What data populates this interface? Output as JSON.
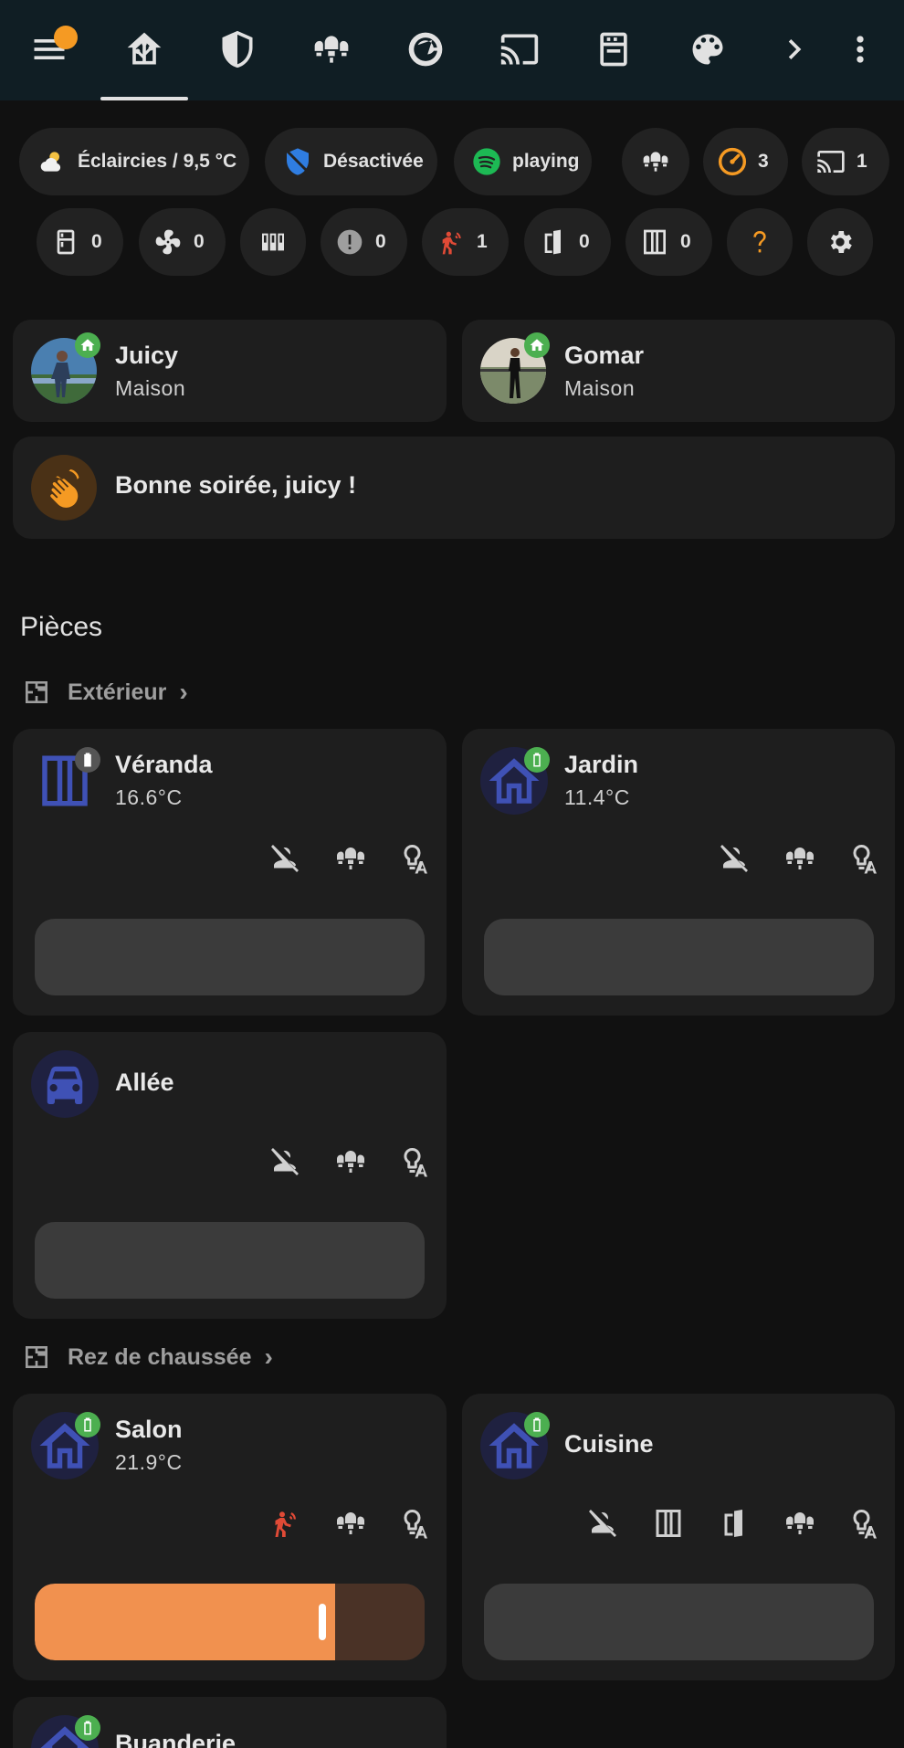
{
  "header": {
    "menu_icon": "menu-icon",
    "tabs": [
      {
        "icon": "home-assistant-icon",
        "active": true
      },
      {
        "icon": "shield-half-icon"
      },
      {
        "icon": "ceiling-light-multiple-icon"
      },
      {
        "icon": "speedometer-icon"
      },
      {
        "icon": "cast-icon"
      },
      {
        "icon": "stove-icon"
      },
      {
        "icon": "palette-icon"
      }
    ],
    "more_tabs_icon": "chevron-right-icon",
    "overflow_icon": "dots-vertical-icon"
  },
  "chips": {
    "weather": "Éclaircies / 9,5 °C",
    "alarm": "Désactivée",
    "spotify": "playing",
    "lights_count": "",
    "meter_count": "3",
    "cast_count": "1",
    "row2": [
      {
        "icon": "fridge-icon",
        "value": "0"
      },
      {
        "icon": "fan-icon",
        "value": "0"
      },
      {
        "icon": "radiator-icon",
        "value": ""
      },
      {
        "icon": "alert-circle-icon",
        "value": "0"
      },
      {
        "icon": "motion-sensor-icon",
        "value": "1"
      },
      {
        "icon": "door-open-icon",
        "value": "0"
      },
      {
        "icon": "window-closed-icon",
        "value": "0"
      },
      {
        "icon": "help-icon",
        "value": ""
      },
      {
        "icon": "cog-icon",
        "value": ""
      }
    ]
  },
  "persons": [
    {
      "name": "Juicy",
      "state": "Maison"
    },
    {
      "name": "Gomar",
      "state": "Maison"
    }
  ],
  "greeting": "Bonne soirée, juicy !",
  "rooms_section": {
    "title": "Pièces",
    "floors": [
      {
        "name": "Extérieur"
      },
      {
        "name": "Rez de chaussée"
      }
    ],
    "rooms": [
      {
        "name": "Véranda",
        "temp": "16.6°C"
      },
      {
        "name": "Jardin",
        "temp": "11.4°C"
      },
      {
        "name": "Allée",
        "temp": ""
      },
      {
        "name": "Salon",
        "temp": "21.9°C",
        "brightness": 0.77
      },
      {
        "name": "Cuisine",
        "temp": ""
      },
      {
        "name": "Buanderie",
        "temp": ""
      }
    ]
  },
  "colors": {
    "background": "#111111",
    "header": "#101e24",
    "card": "#1e1e1e",
    "chip": "#222222",
    "accent_orange": "#f59a23",
    "room_icon_blue": "#3f51b5",
    "badge_green": "#4caf50",
    "motion_red": "#e04a36",
    "slider_orange": "#f1914f"
  }
}
